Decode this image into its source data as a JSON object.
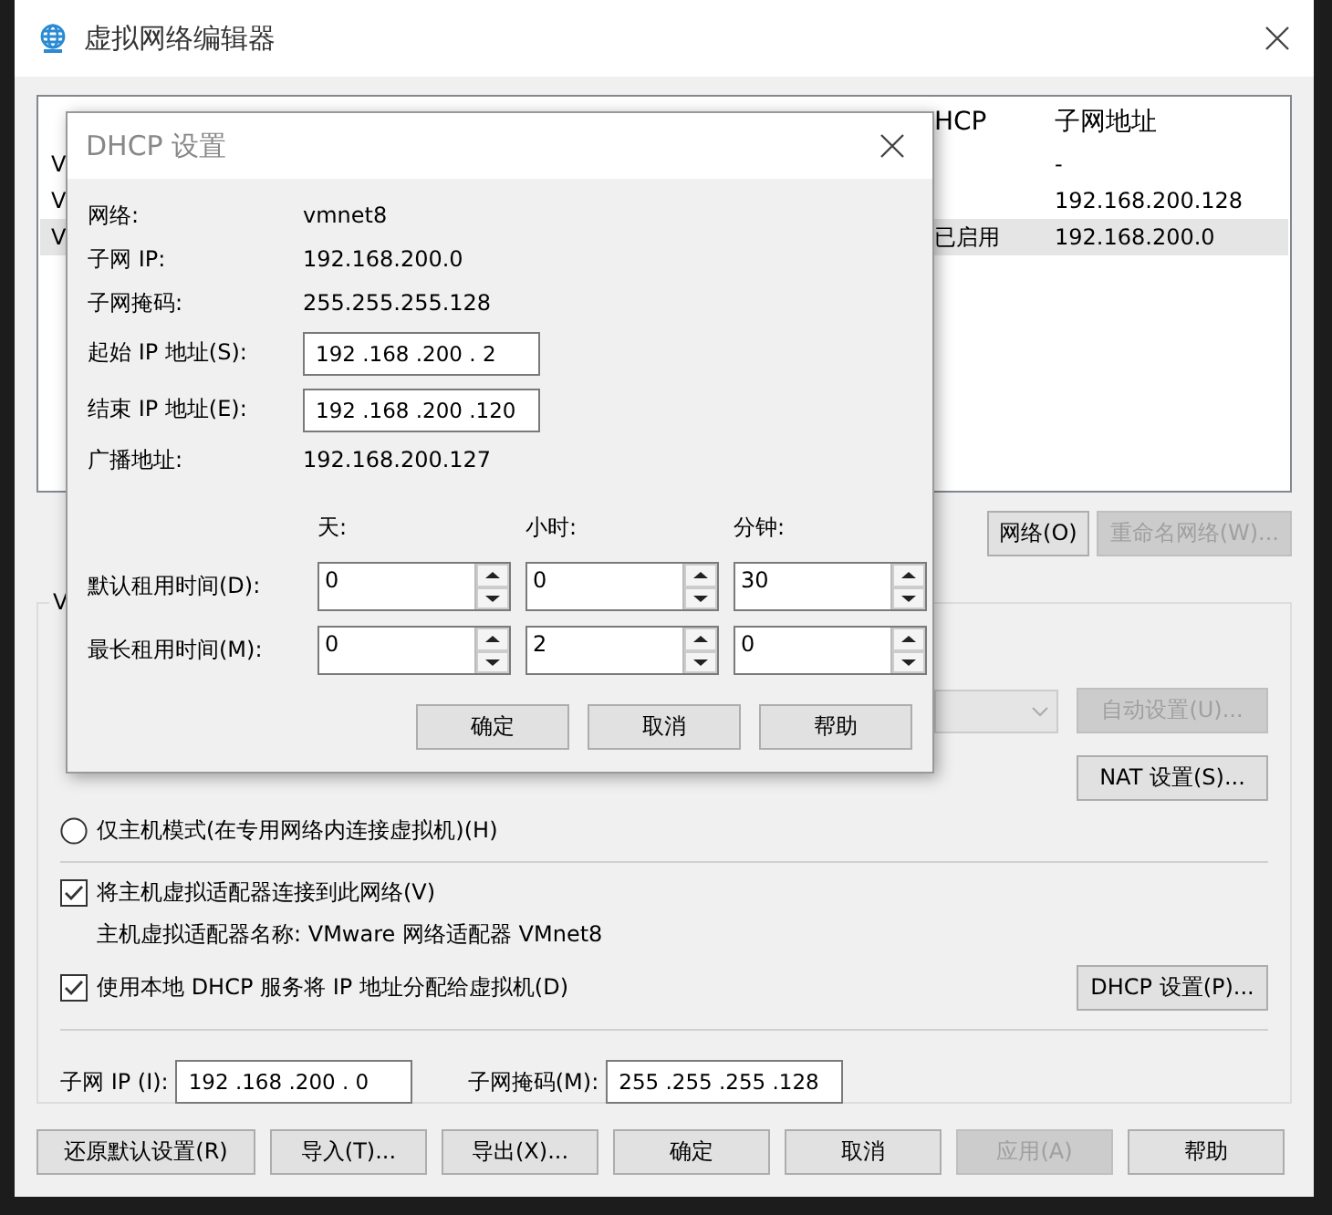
{
  "window": {
    "title": "虚拟网络编辑器"
  },
  "network_table": {
    "columns": [
      "HCP",
      "子网地址"
    ],
    "rows": [
      {
        "name": "V",
        "subnet": "-",
        "selected": false
      },
      {
        "name": "V",
        "subnet": "192.168.200.128",
        "selected": false
      },
      {
        "name": "V",
        "dhcp": "已启用",
        "subnet": "192.168.200.0",
        "selected": true
      }
    ]
  },
  "network_buttons": [
    {
      "label": "网络(O)",
      "disabled": false
    },
    {
      "label": "重命名网络(W)...",
      "disabled": true
    }
  ],
  "vmnet_info": {
    "title": "V",
    "bridge_dropdown": {
      "disabled": true
    },
    "auto_button": {
      "label": "自动设置(U)...",
      "disabled": true
    },
    "nat_button": {
      "label": "NAT 设置(S)...",
      "disabled": false
    },
    "host_only": {
      "label": "仅主机模式(在专用网络内连接虚拟机)(H)",
      "selected": false
    },
    "connect_adapter": {
      "label": "将主机虚拟适配器连接到此网络(V)",
      "checked": true
    },
    "adapter_name": "主机虚拟适配器名称: VMware 网络适配器 VMnet8",
    "use_dhcp": {
      "label": "使用本地 DHCP 服务将 IP 地址分配给虚拟机(D)",
      "checked": true
    },
    "dhcp_button": {
      "label": "DHCP 设置(P)...",
      "disabled": false
    },
    "subnet_ip": {
      "label": "子网 IP (I):",
      "value": "192 .168 .200 . 0"
    },
    "subnet_mask": {
      "label": "子网掩码(M):",
      "value": "255 .255 .255 .128"
    }
  },
  "bottom_buttons": [
    {
      "label": "还原默认设置(R)",
      "disabled": false
    },
    {
      "label": "导入(T)...",
      "disabled": false
    },
    {
      "label": "导出(X)...",
      "disabled": false
    },
    {
      "label": "确定",
      "disabled": false
    },
    {
      "label": "取消",
      "disabled": false
    },
    {
      "label": "应用(A)",
      "disabled": true
    },
    {
      "label": "帮助",
      "disabled": false
    }
  ],
  "dhcp_dialog": {
    "title": "DHCP 设置",
    "info": [
      {
        "kind": "text",
        "label": "网络:",
        "value": "vmnet8"
      },
      {
        "kind": "text",
        "label": "子网 IP:",
        "value": "192.168.200.0"
      },
      {
        "kind": "text",
        "label": "子网掩码:",
        "value": "255.255.255.128"
      },
      {
        "kind": "field",
        "label": "起始 IP 地址(S):",
        "value": "192 .168 .200 . 2"
      },
      {
        "kind": "field",
        "label": "结束 IP 地址(E):",
        "value": "192 .168 .200 .120"
      },
      {
        "kind": "text",
        "label": "广播地址:",
        "value": "192.168.200.127"
      }
    ],
    "lease_headers": [
      "天:",
      "小时:",
      "分钟:"
    ],
    "lease_rows": [
      {
        "label": "默认租用时间(D):",
        "values": [
          "0",
          "0",
          "30"
        ]
      },
      {
        "label": "最长租用时间(M):",
        "values": [
          "0",
          "2",
          "0"
        ]
      }
    ],
    "buttons": [
      "确定",
      "取消",
      "帮助"
    ]
  }
}
